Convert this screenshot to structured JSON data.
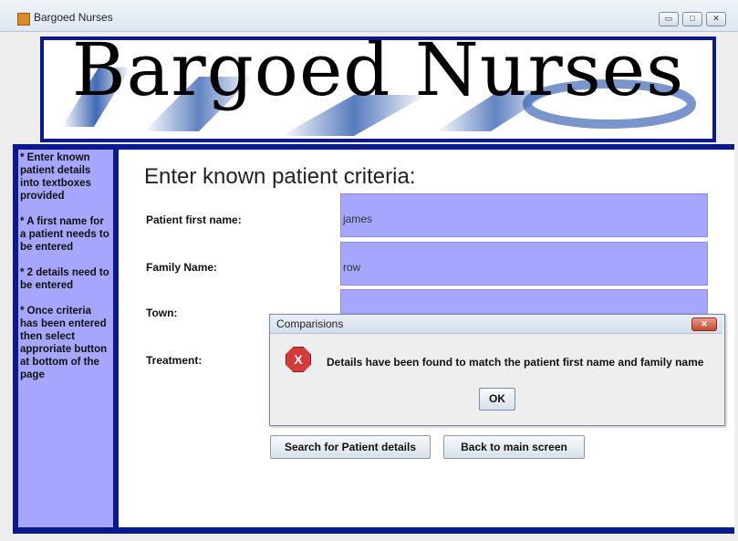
{
  "window": {
    "title": "Bargoed Nurses",
    "controls": {
      "minimize": "▭",
      "maximize": "□",
      "close": "✕"
    }
  },
  "banner": {
    "title": "Bargoed Nurses"
  },
  "sidebar": {
    "lines": [
      "* Enter known patient details into textboxes provided",
      "* A first name for a patient needs to be entered",
      "* 2 details need to be entered",
      "* Once criteria has been entered then select approriate button at bottom of the page"
    ]
  },
  "form": {
    "heading": "Enter known patient criteria:",
    "fields": [
      {
        "label": "Patient first name:",
        "value": "james"
      },
      {
        "label": "Family Name:",
        "value": "row"
      },
      {
        "label": "Town:",
        "value": ""
      },
      {
        "label": "Treatment:",
        "value": ""
      }
    ],
    "buttons": {
      "search": "Search for Patient details",
      "back": "Back to main screen"
    }
  },
  "dialog": {
    "title": "Comparisions",
    "close_label": "✕",
    "icon_label": "X",
    "message": "Details have been found to match the patient first name and family name",
    "ok_label": "OK"
  },
  "colors": {
    "border_blue": "#0a1a8c",
    "panel_lilac": "#a6a6ff"
  }
}
